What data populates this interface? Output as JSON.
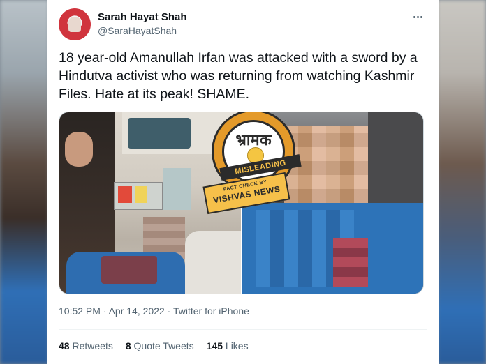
{
  "tweet": {
    "display_name": "Sarah Hayat Shah",
    "handle": "@SaraHayatShah",
    "text": "18 year-old Amanullah Irfan was attacked with a sword by a Hindutva activist who was returning from watching Kashmir Files. Hate at its peak! SHAME.",
    "timestamp": "10:52 PM · Apr 14, 2022 · Twitter for iPhone",
    "stats": {
      "retweets_count": "48",
      "retweets_label": "Retweets",
      "quote_count": "8",
      "quote_label": "Quote Tweets",
      "likes_count": "145",
      "likes_label": "Likes"
    }
  },
  "stamp": {
    "top_text": "भ्रामक",
    "band_text": "MISLEADING",
    "banner_line1": "FACT CHECK BY",
    "banner_line2": "VISHVAS NEWS"
  },
  "icons": {
    "more": "more-horizontal-icon"
  },
  "colors": {
    "text_primary": "#0f1419",
    "text_secondary": "#536471",
    "stamp_orange": "#e49a2a",
    "stamp_yellow": "#f6c04a"
  }
}
